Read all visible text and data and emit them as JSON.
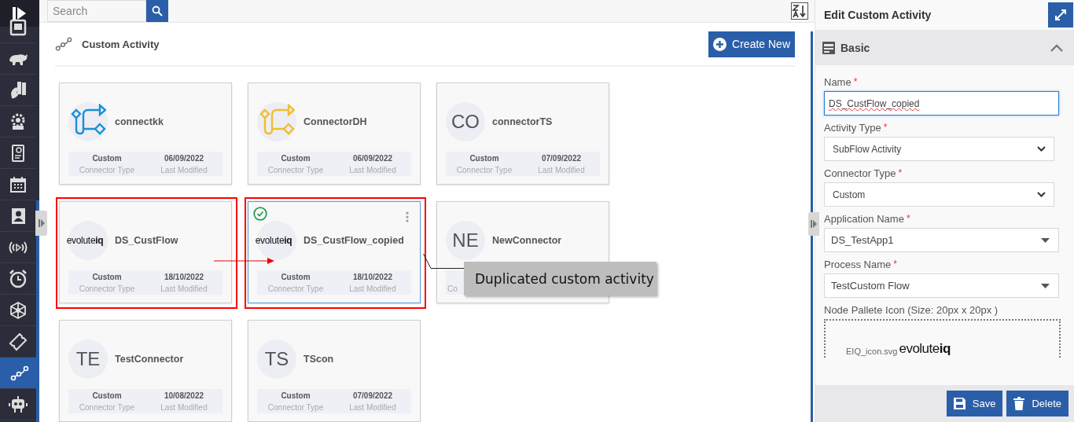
{
  "sidebar": {
    "items": [
      {
        "selected": false
      },
      {
        "selected": false
      },
      {
        "selected": false
      },
      {
        "selected": false
      },
      {
        "selected": false
      },
      {
        "selected": false
      },
      {
        "selected": false
      },
      {
        "selected": false
      },
      {
        "selected": false
      },
      {
        "selected": false
      },
      {
        "selected": false
      },
      {
        "selected": true
      },
      {
        "selected": false
      }
    ]
  },
  "search": {
    "placeholder": "Search"
  },
  "page": {
    "title": "Custom Activity",
    "create_button": "Create New"
  },
  "cards": [
    {
      "name": "connectkk",
      "logo": {
        "kind": "flow",
        "color": "#1a8fd6"
      },
      "type": "Custom",
      "type_label": "Connector Type",
      "date": "06/09/2022",
      "date_label": "Last Modified",
      "selected": false,
      "highlighted": false
    },
    {
      "name": "ConnectorDH",
      "logo": {
        "kind": "flow",
        "color": "#f2bd2c"
      },
      "type": "Custom",
      "type_label": "Connector Type",
      "date": "06/09/2022",
      "date_label": "Last Modified",
      "selected": false,
      "highlighted": false
    },
    {
      "name": "connectorTS",
      "logo": {
        "kind": "initials",
        "text": "CO"
      },
      "type": "Custom",
      "type_label": "Connector Type",
      "date": "07/09/2022",
      "date_label": "Last Modified",
      "selected": false,
      "highlighted": false
    },
    {
      "name": "DS_CustFlow",
      "logo": {
        "kind": "wordmark",
        "text": "evolute**iq**"
      },
      "type": "Custom",
      "type_label": "Connector Type",
      "date": "18/10/2022",
      "date_label": "Last Modified",
      "selected": false,
      "highlighted": true
    },
    {
      "name": "DS_CustFlow_copied",
      "logo": {
        "kind": "wordmark",
        "text": "evolute**iq**"
      },
      "type": "Custom",
      "type_label": "Connector Type",
      "date": "18/10/2022",
      "date_label": "Last Modified",
      "selected": true,
      "highlighted": true
    },
    {
      "name": "NewConnector",
      "logo": {
        "kind": "initials",
        "text": "NE"
      },
      "type_label": "Co",
      "selected": false,
      "highlighted": false
    },
    {
      "name": "TestConnector",
      "logo": {
        "kind": "initials",
        "text": "TE"
      },
      "type": "Custom",
      "type_label": "Connector Type",
      "date": "10/08/2022",
      "date_label": "Last Modified",
      "selected": false,
      "highlighted": false
    },
    {
      "name": "TScon",
      "logo": {
        "kind": "initials",
        "text": "TS"
      },
      "type": "Custom",
      "type_label": "Connector Type",
      "date": "07/09/2022",
      "date_label": "Last Modified",
      "selected": false,
      "highlighted": false
    }
  ],
  "callout": {
    "text": "Duplicated custom activity"
  },
  "panel": {
    "title": "Edit Custom Activity",
    "section": {
      "title": "Basic",
      "expanded": true
    },
    "fields": [
      {
        "kind": "input",
        "label": "Name",
        "required_mark": "*",
        "value": "DS_CustFlow_copied",
        "focused": true
      },
      {
        "kind": "select",
        "label": "Activity Type",
        "required_mark": "*",
        "value": "SubFlow Activity"
      },
      {
        "kind": "select",
        "label": "Connector Type",
        "required_mark": "*",
        "value": "Custom"
      },
      {
        "kind": "combo",
        "label": "Application Name",
        "required_mark": "*",
        "value": "DS_TestApp1"
      },
      {
        "kind": "combo",
        "label": "Process Name",
        "required_mark": "*",
        "value": "TestCustom Flow"
      }
    ],
    "upload": {
      "label": "Node Pallete Icon (Size: 20px x 20px )",
      "file": "EIQ_icon.svg",
      "logo": "evolute**iq**"
    },
    "buttons": [
      {
        "kind": "save",
        "label": "Save"
      },
      {
        "kind": "delete",
        "label": "Delete"
      }
    ]
  }
}
